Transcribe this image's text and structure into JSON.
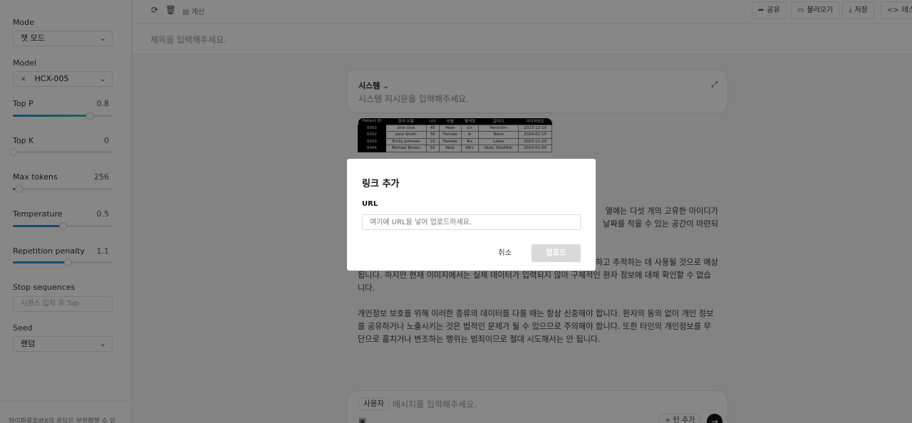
{
  "sidebar": {
    "mode": {
      "label": "Mode",
      "value": "챗 모드"
    },
    "model": {
      "label": "Model",
      "value": "HCX-005"
    },
    "top_p": {
      "label": "Top P",
      "value": "0.8",
      "fraction": 0.77
    },
    "top_k": {
      "label": "Top K",
      "value": "0",
      "fraction": 0.0
    },
    "max_tokens": {
      "label": "Max tokens",
      "value": "256",
      "fraction": 0.06
    },
    "temperature": {
      "label": "Temperature",
      "value": "0.5",
      "fraction": 0.5
    },
    "repetition_penalty": {
      "label": "Repetition penalty",
      "value": "1.1",
      "fraction": 0.55
    },
    "stop_sequences": {
      "label": "Stop sequences",
      "placeholder": "시퀀스 입력 후 Tab"
    },
    "seed": {
      "label": "Seed",
      "value": "랜덤"
    },
    "footer": "하이퍼클로바X의 응답은 부정확할 수 있"
  },
  "topbar": {
    "calc_label": "계산",
    "share": "공유",
    "load": "불러오기",
    "save": "저장",
    "test": "테스트"
  },
  "title_placeholder": "제목을 입력해주세요.",
  "system": {
    "title": "시스템",
    "placeholder": "시스템 지시문을 입력해주세요."
  },
  "image_table": {
    "headers": [
      "Patient ID",
      "환자 이름",
      "나이",
      "성별",
      "혈액형",
      "알러지",
      "마지막방문"
    ],
    "rows": [
      [
        "0001",
        "John Doe",
        "45",
        "Male",
        "O+",
        "Penicillin",
        "2023-12-10"
      ],
      [
        "0002",
        "Jane Smith",
        "30",
        "Female",
        "A-",
        "None",
        "2024-01-15"
      ],
      [
        "0003",
        "Emily Johnson",
        "22",
        "Female",
        "B+",
        "Latex",
        "2023-11-20"
      ],
      [
        "0004",
        "Michael Brown",
        "55",
        "Male",
        "AB+",
        "Nuts, Shellfish",
        "2024-01-05"
      ]
    ]
  },
  "messages": {
    "line1_tail": "열에는 다섯 개의 고유한 아이디가",
    "line2_tail": "날짜를 적을 수 있는 공간이 마련되",
    "line3_tail": "하고 추적하는 데 사용될 것으로 예상",
    "para2": "됩니다. 하지만 현재 이미지에서는 실제 데이터가 입력되지 않아 구체적인 환자 정보에 대해 확인할 수 없습니다.",
    "para3": "개인정보 보호를 위해 이러한 종류의 데이터를 다룰 때는 항상 신중해야 합니다. 환자의 동의 없이 개인 정보를 공유하거나 노출시키는 것은 법적인 문제가 될 수 있으므로 주의해야 합니다. 또한 타인의 개인정보를 무단으로 훔치거나 변조하는 행위는 범죄이므로 절대 시도해서는 안 됩니다."
  },
  "composer": {
    "role": "사용자",
    "placeholder": "메시지를 입력해주세요.",
    "add_turn": "턴 추가"
  },
  "modal": {
    "title": "링크 추가",
    "url_label": "URL",
    "url_placeholder": "여기에 URL을 넣어 업로드하세요.",
    "cancel": "취소",
    "upload": "업로드"
  }
}
